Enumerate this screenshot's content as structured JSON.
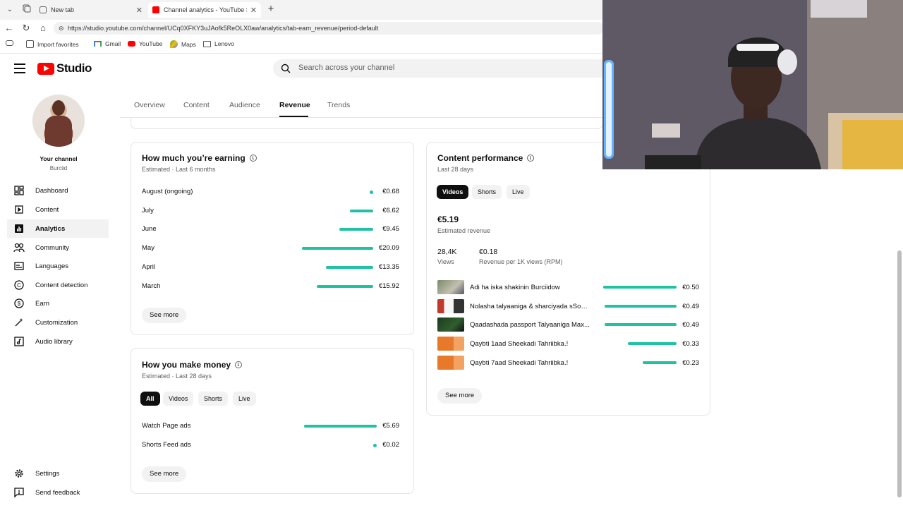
{
  "browser": {
    "tabs": [
      {
        "label": "New tab"
      },
      {
        "label": "Channel analytics - YouTube Studio"
      }
    ],
    "url": "https://studio.youtube.com/channel/UCq0XFKY3uJAofk5ReOLX0aw/analytics/tab-earn_revenue/period-default",
    "bookmarks": [
      "Import favorites",
      "Gmail",
      "YouTube",
      "Maps",
      "Lenovo"
    ]
  },
  "header": {
    "logo_text": "Studio",
    "search_placeholder": "Search across your channel"
  },
  "sidebar": {
    "your_channel": "Your channel",
    "channel_name": "Burciid",
    "items": [
      {
        "label": "Dashboard",
        "icon": "dashboard-icon"
      },
      {
        "label": "Content",
        "icon": "content-icon"
      },
      {
        "label": "Analytics",
        "icon": "analytics-icon",
        "active": true
      },
      {
        "label": "Community",
        "icon": "community-icon"
      },
      {
        "label": "Languages",
        "icon": "languages-icon"
      },
      {
        "label": "Content detection",
        "icon": "copyright-icon"
      },
      {
        "label": "Earn",
        "icon": "dollar-icon"
      },
      {
        "label": "Customization",
        "icon": "wand-icon"
      },
      {
        "label": "Audio library",
        "icon": "audio-library-icon"
      }
    ],
    "bottom": [
      {
        "label": "Settings",
        "icon": "gear-icon"
      },
      {
        "label": "Send feedback",
        "icon": "feedback-icon"
      }
    ]
  },
  "analytics_tabs": [
    "Overview",
    "Content",
    "Audience",
    "Revenue",
    "Trends"
  ],
  "earning": {
    "title": "How much you’re earning",
    "subtitle": "Estimated · Last 6 months",
    "rows": [
      {
        "month": "August (ongoing)",
        "value": "€0.68",
        "amount": 0.68
      },
      {
        "month": "July",
        "value": "€6.62",
        "amount": 6.62
      },
      {
        "month": "June",
        "value": "€9.45",
        "amount": 9.45
      },
      {
        "month": "May",
        "value": "€20.09",
        "amount": 20.09
      },
      {
        "month": "April",
        "value": "€13.35",
        "amount": 13.35
      },
      {
        "month": "March",
        "value": "€15.92",
        "amount": 15.92
      }
    ],
    "see_more": "See more"
  },
  "make_money": {
    "title": "How you make money",
    "subtitle": "Estimated · Last 28 days",
    "chips": [
      "All",
      "Videos",
      "Shorts",
      "Live"
    ],
    "rows": [
      {
        "label": "Watch Page ads",
        "value": "€5.69",
        "amount": 5.69
      },
      {
        "label": "Shorts Feed ads",
        "value": "€0.02",
        "amount": 0.02
      }
    ],
    "see_more": "See more"
  },
  "content_performance": {
    "title": "Content performance",
    "subtitle": "Last 28 days",
    "chips": [
      "Videos",
      "Shorts",
      "Live"
    ],
    "revenue": "€5.19",
    "revenue_label": "Estimated revenue",
    "views": "28,4K",
    "views_label": "Views",
    "rpm": "€0.18",
    "rpm_label": "Revenue per 1K views (RPM)",
    "videos": [
      {
        "title": "Adi ha iska shakinin Burciidow",
        "value": "€0.50",
        "amount": 0.5
      },
      {
        "title": "Nolasha talyaaniga & sharciyada sSomaalida",
        "value": "€0.49",
        "amount": 0.49
      },
      {
        "title": "Qaadashada passport Talyaaniga Max...",
        "value": "€0.49",
        "amount": 0.49
      },
      {
        "title": "Qaybti 1aad Sheekadi Tahriibka.!",
        "value": "€0.33",
        "amount": 0.33
      },
      {
        "title": "Qaybti 7aad Sheekadi Tahriibka.!",
        "value": "€0.23",
        "amount": 0.23
      }
    ],
    "see_more": "See more"
  },
  "colors": {
    "accent": "#1fc2a2",
    "brand_red": "#ff0000"
  }
}
